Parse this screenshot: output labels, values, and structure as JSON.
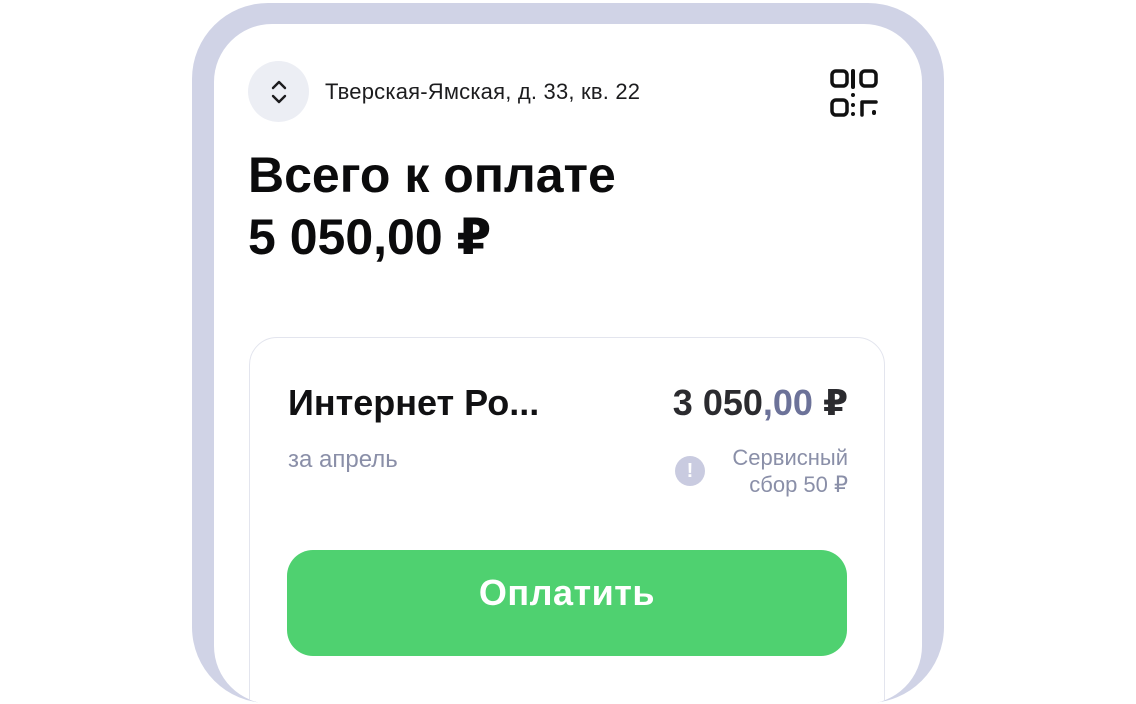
{
  "header": {
    "address_switch_icon": "chevron-up-down-icon",
    "address": "Тверская-Ямская, д. 33, кв. 22",
    "qr_icon": "qr-code-icon"
  },
  "summary": {
    "title": "Всего к оплате",
    "amount": "5 050,00 ₽"
  },
  "bill": {
    "service_name": "Интернет Ро...",
    "amount_main": "3 050",
    "amount_kop": ",00",
    "amount_currency": " ₽",
    "period": "за апрель",
    "fee_icon": "exclamation-icon",
    "fee_icon_glyph": "!",
    "fee_line1": "Сервисный",
    "fee_line2": "сбор 50 ₽",
    "pay_label": "Оплатить"
  },
  "colors": {
    "frame": "#d0d3e6",
    "pay_button": "#4fd170",
    "muted_text": "#8a8fa8",
    "kopeck_accent": "#6c7299"
  }
}
